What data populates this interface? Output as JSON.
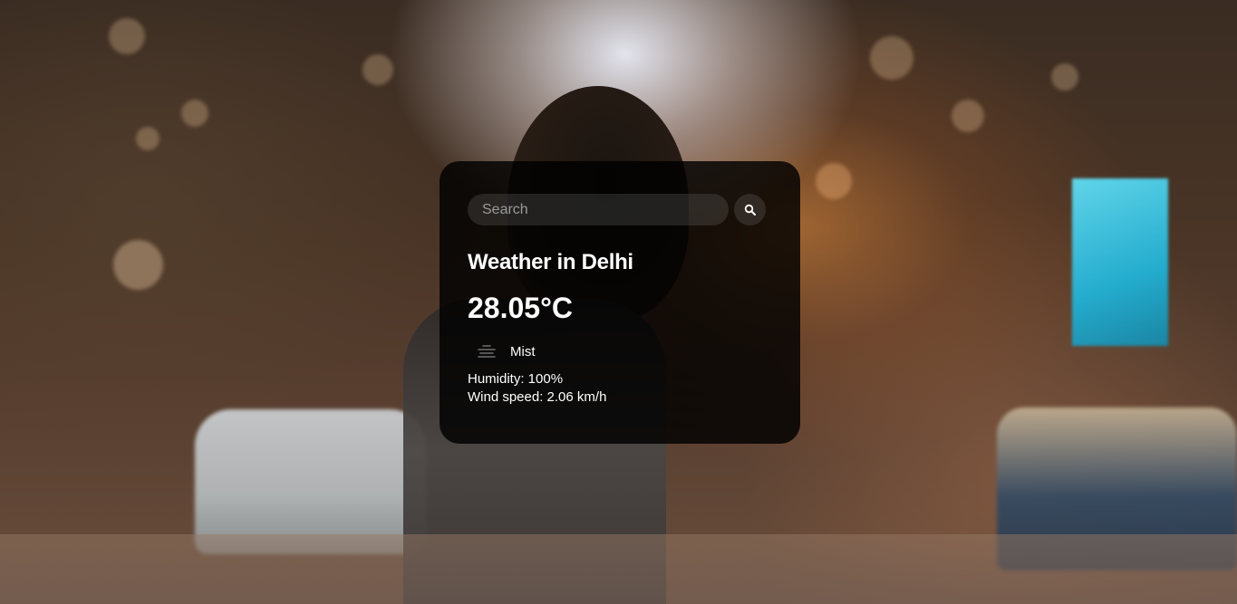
{
  "search": {
    "placeholder": "Search",
    "value": "",
    "button_icon": "search-icon"
  },
  "weather": {
    "city_heading": "Weather in Delhi",
    "temperature": "28.05°C",
    "condition_icon": "mist-icon",
    "description": "Mist",
    "humidity": "Humidity: 100%",
    "wind_speed": "Wind speed: 2.06 km/h"
  },
  "colors": {
    "card_background": "#000000",
    "text": "#ffffff",
    "input_background": "#7c7c7c"
  }
}
